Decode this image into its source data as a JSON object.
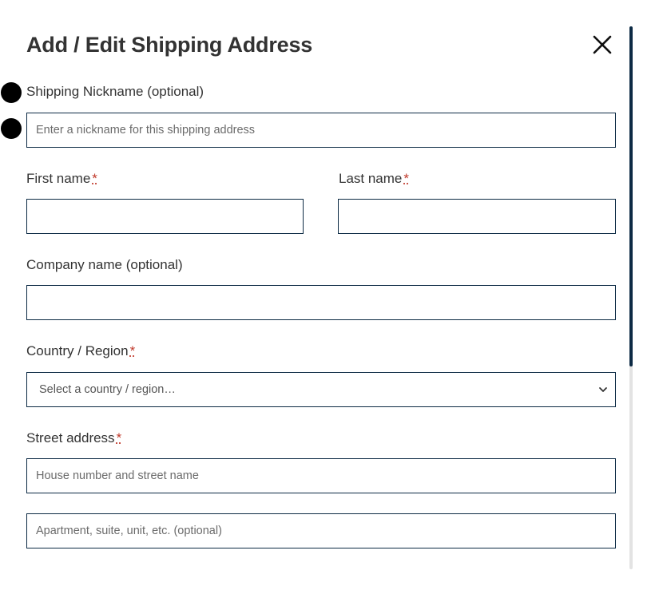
{
  "modal": {
    "title": "Add / Edit Shipping Address",
    "close_icon": "close-icon"
  },
  "form": {
    "nickname": {
      "label": "Shipping Nickname (optional)",
      "placeholder": "Enter a nickname for this shipping address",
      "value": ""
    },
    "first_name": {
      "label": "First name",
      "required_mark": "*",
      "value": ""
    },
    "last_name": {
      "label": "Last name",
      "required_mark": "*",
      "value": ""
    },
    "company": {
      "label": "Company name (optional)",
      "value": ""
    },
    "country": {
      "label": "Country / Region",
      "required_mark": "*",
      "selected": "Select a country / region…",
      "icon": "chevron-down-icon"
    },
    "street": {
      "label": "Street address",
      "required_mark": "*",
      "line1_placeholder": "House number and street name",
      "line2_placeholder": "Apartment, suite, unit, etc. (optional)",
      "line1_value": "",
      "line2_value": ""
    }
  },
  "colors": {
    "border": "#0c2a44",
    "required": "#c0392b",
    "scrollbar_thumb": "#0c2a44",
    "scrollbar_track": "#e3e3e3"
  }
}
